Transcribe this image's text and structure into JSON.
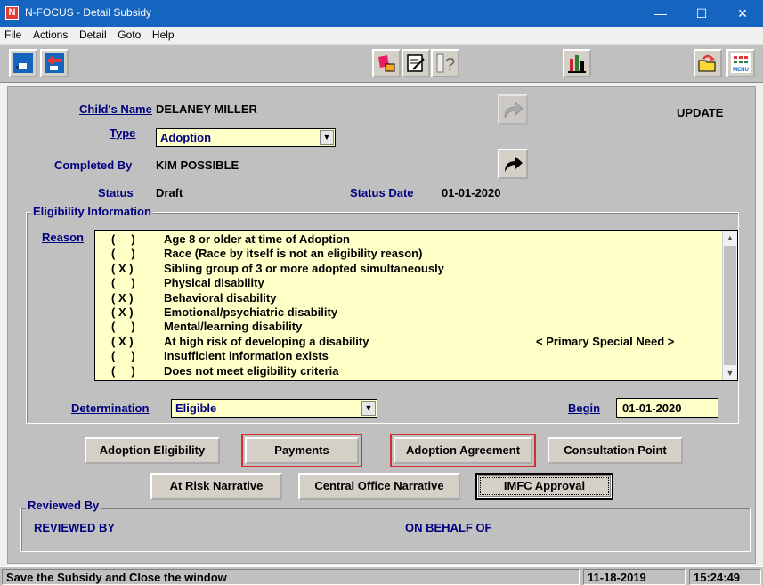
{
  "window": {
    "title": "N-FOCUS - Detail Subsidy",
    "app_icon_letter": "N",
    "minimize": "—",
    "maximize": "☐",
    "close": "✕"
  },
  "menu": [
    "File",
    "Actions",
    "Detail",
    "Goto",
    "Help"
  ],
  "toolbar": {
    "left": [
      "save-exit-icon",
      "back-icon"
    ],
    "middle": [
      "notes-icon",
      "edit-icon",
      "help-icon"
    ],
    "chart": "bar-chart-icon",
    "right": [
      "folder-open-icon",
      "menu-icon"
    ],
    "menu_label": "MENU",
    "help_glyph": "?"
  },
  "form": {
    "mode": "UPDATE",
    "child_name_label": "Child's Name",
    "child_name": "DELANEY MILLER",
    "type_label": "Type",
    "type_value": "Adoption",
    "completed_by_label": "Completed By",
    "completed_by": "KIM POSSIBLE",
    "status_label": "Status",
    "status_value": "Draft",
    "status_date_label": "Status Date",
    "status_date": "01-01-2020"
  },
  "eligibility": {
    "legend": "Eligibility Information",
    "reason_label": "Reason",
    "items": [
      {
        "check": "(     )",
        "text": "Age 8 or older at time of Adoption",
        "note": ""
      },
      {
        "check": "(     )",
        "text": "Race (Race by itself is not an eligibility reason)",
        "note": ""
      },
      {
        "check": "( X )",
        "text": "Sibling group of 3 or more adopted simultaneously",
        "note": ""
      },
      {
        "check": "(     )",
        "text": "Physical disability",
        "note": ""
      },
      {
        "check": "( X )",
        "text": "Behavioral disability",
        "note": ""
      },
      {
        "check": "( X )",
        "text": "Emotional/psychiatric disability",
        "note": ""
      },
      {
        "check": "(     )",
        "text": "Mental/learning disability",
        "note": ""
      },
      {
        "check": "( X )",
        "text": "At high risk of developing a disability",
        "note": "< Primary Special Need >"
      },
      {
        "check": "(     )",
        "text": "Insufficient information exists",
        "note": ""
      },
      {
        "check": "(     )",
        "text": "Does not meet eligibility criteria",
        "note": ""
      }
    ],
    "determination_label": "Determination",
    "determination_value": "Eligible",
    "begin_label": "Begin",
    "begin_value": "01-01-2020"
  },
  "buttons": {
    "adoption_eligibility": "Adoption Eligibility",
    "payments": "Payments",
    "adoption_agreement": "Adoption Agreement",
    "consultation_point": "Consultation Point",
    "at_risk_narrative": "At Risk Narrative",
    "central_office_narrative": "Central Office Narrative",
    "imfc_approval": "IMFC Approval"
  },
  "reviewed": {
    "legend": "Reviewed By",
    "reviewed_by_label": "REVIEWED BY",
    "on_behalf_of_label": "ON BEHALF OF"
  },
  "status_bar": {
    "message": "Save the Subsidy and Close the window",
    "date": "11-18-2019",
    "time": "15:24:49"
  },
  "colors": {
    "titlebar": "#1565c0",
    "label_blue": "#00007f",
    "field_yellow": "#ffffc8",
    "highlight_red": "#d32f2f",
    "panel_gray": "#c0c0c0"
  }
}
